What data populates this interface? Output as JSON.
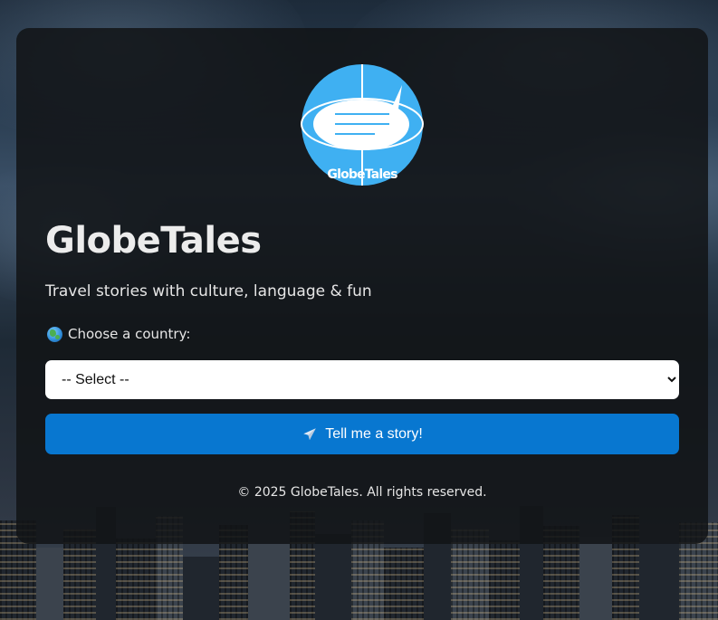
{
  "logo": {
    "text": "GlobeTales",
    "icon": "globe-speech-bubble-icon",
    "colors": {
      "globe": "#3fb0f2",
      "bubble": "#ffffff",
      "lines": "#3fb0f2"
    }
  },
  "header": {
    "title": "GlobeTales",
    "subtitle": "Travel stories with culture, language & fun"
  },
  "form": {
    "country_label": "Choose a country:",
    "country_label_icon": "globe-icon",
    "select": {
      "selected": "-- Select --",
      "options": [
        "-- Select --"
      ]
    },
    "submit_label": "Tell me a story!",
    "submit_icon": "airplane-icon"
  },
  "footer": {
    "text": "© 2025 GlobeTales. All rights reserved."
  },
  "colors": {
    "accent": "#0877d0",
    "card_background": "#121416",
    "text": "#ececec"
  }
}
